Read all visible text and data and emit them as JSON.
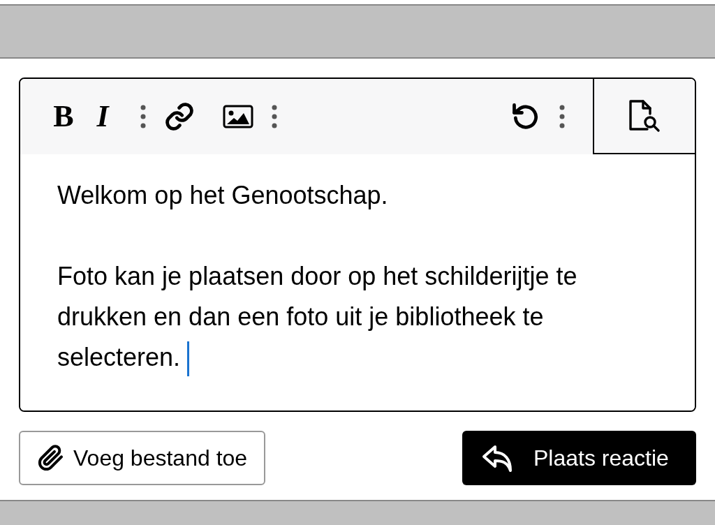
{
  "toolbar": [
    {
      "kind": "bold",
      "label": "B"
    },
    {
      "kind": "italic",
      "label": "I"
    },
    {
      "kind": "more"
    },
    {
      "kind": "link"
    },
    {
      "kind": "image"
    },
    {
      "kind": "more"
    },
    {
      "kind": "spacer"
    },
    {
      "kind": "undo"
    },
    {
      "kind": "more"
    }
  ],
  "paragraphs": [
    "Welkom op het Genootschap.",
    "Foto kan je plaatsen door op het schilderijtje te drukken en dan een foto uit je bibliotheek te selecteren."
  ],
  "buttons": [
    {
      "kind": "attach",
      "label": "Voeg bestand toe"
    },
    {
      "kind": "post",
      "label": "Plaats reactie"
    }
  ]
}
